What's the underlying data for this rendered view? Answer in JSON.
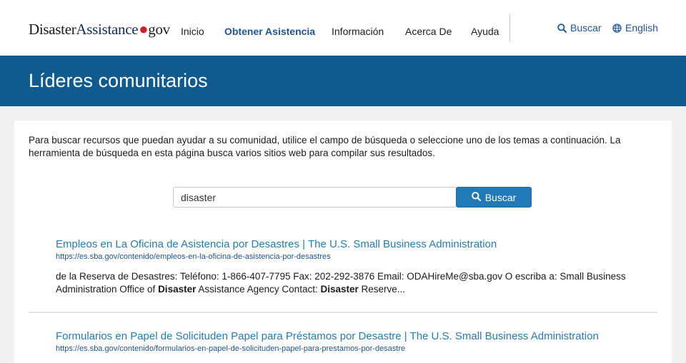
{
  "header": {
    "logo": {
      "part1": "Disaster",
      "part2": "Assistance",
      "dot": "●",
      "part3": "gov"
    },
    "nav": [
      {
        "label": "Inicio",
        "active": false
      },
      {
        "label": "Obtener Asistencia",
        "active": true
      },
      {
        "label": "Información",
        "active": false
      },
      {
        "label": "Acerca De",
        "active": false
      },
      {
        "label": "Ayuda",
        "active": false
      }
    ],
    "search_link": "Buscar",
    "language_link": "English"
  },
  "hero": {
    "title": "Líderes comunitarios"
  },
  "main": {
    "intro": "Para buscar recursos que puedan ayudar a su comunidad, utilice el campo de búsqueda o seleccione uno de los temas a continuación. La herramienta de búsqueda en esta página busca varios sitios web para compilar sus resultados.",
    "search": {
      "value": "disaster",
      "button_label": "Buscar"
    },
    "results": [
      {
        "title": "Empleos en La Oficina de Asistencia por Desastres | The U.S. Small Business Administration",
        "url": "https://es.sba.gov/contenido/empleos-en-la-oficina-de-asistencia-por-desastres",
        "snippet": [
          {
            "t": "de la Reserva de Desastres: Teléfono: 1-866-407-7795 Fax: 202-292-3876 Email: ODAHireMe@sba.gov O escriba a: Small Business Administration Office of ",
            "b": false
          },
          {
            "t": "Disaster",
            "b": true
          },
          {
            "t": " Assistance Agency Contact: ",
            "b": false
          },
          {
            "t": "Disaster",
            "b": true
          },
          {
            "t": " Reserve...",
            "b": false
          }
        ]
      },
      {
        "title": "Formularios en Papel de Solicituden Papel para Préstamos por Desastre | The U.S. Small Business Administration",
        "url": "https://es.sba.gov/contenido/formularios-en-papel-de-solicituden-papel-para-prestamos-por-desastre"
      }
    ]
  },
  "colors": {
    "brand_blue": "#0f5a8e",
    "link": "#2a7ab0",
    "button": "#2179b5",
    "logo_dot": "#cd2026"
  },
  "icons": {
    "search": "search-icon",
    "language": "globe-icon"
  }
}
